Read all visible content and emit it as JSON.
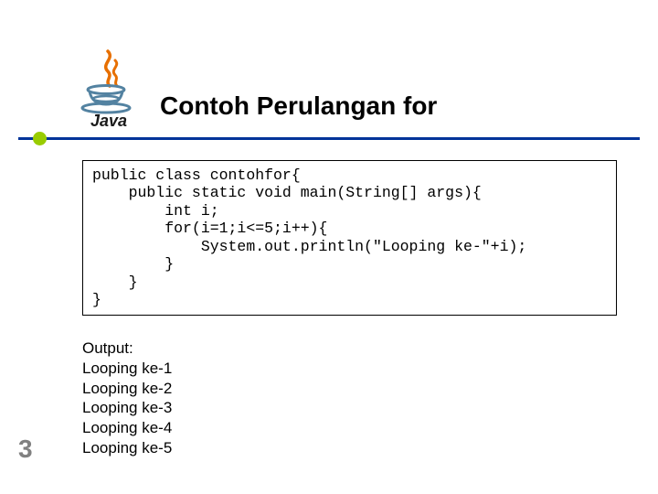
{
  "title": "Contoh Perulangan for",
  "code_lines": [
    "public class contohfor{",
    "    public static void main(String[] args){",
    "        int i;",
    "        for(i=1;i<=5;i++){",
    "            System.out.println(\"Looping ke-\"+i);",
    "        }",
    "    }",
    "}"
  ],
  "output_label": "Output:",
  "output_lines": [
    "Looping ke-1",
    "Looping ke-2",
    "Looping ke-3",
    "Looping ke-4",
    "Looping ke-5"
  ],
  "page_number": "3",
  "logo_alt": "Java"
}
